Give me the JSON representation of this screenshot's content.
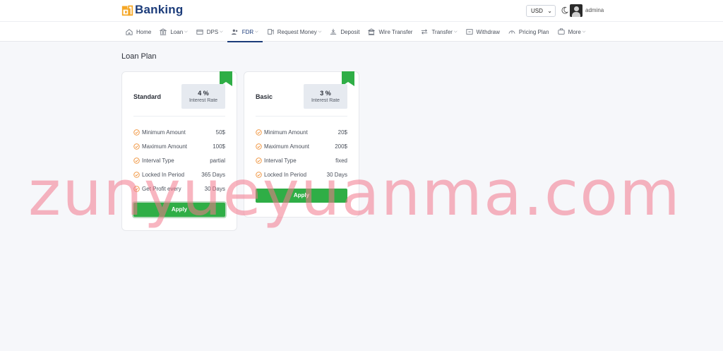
{
  "brand": {
    "name": "Banking"
  },
  "topbar": {
    "currency": "USD",
    "username": "admina"
  },
  "nav": [
    {
      "label": "Home",
      "icon": "home-icon",
      "dropdown": false
    },
    {
      "label": "Loan",
      "icon": "bank-icon",
      "dropdown": true
    },
    {
      "label": "DPS",
      "icon": "card-icon",
      "dropdown": true
    },
    {
      "label": "FDR",
      "icon": "users-icon",
      "dropdown": true,
      "active": true
    },
    {
      "label": "Request Money",
      "icon": "request-money-icon",
      "dropdown": true
    },
    {
      "label": "Deposit",
      "icon": "deposit-icon",
      "dropdown": false
    },
    {
      "label": "Wire Transfer",
      "icon": "wire-transfer-icon",
      "dropdown": false
    },
    {
      "label": "Transfer",
      "icon": "transfer-icon",
      "dropdown": true
    },
    {
      "label": "Withdraw",
      "icon": "withdraw-icon",
      "dropdown": false
    },
    {
      "label": "Pricing Plan",
      "icon": "pricing-plan-icon",
      "dropdown": false
    },
    {
      "label": "More",
      "icon": "more-icon",
      "dropdown": true
    }
  ],
  "page": {
    "title": "Loan Plan"
  },
  "plans": [
    {
      "name": "Standard",
      "rate": "4 %",
      "rate_label": "Interest Rate",
      "rows": [
        {
          "label": "Minimum Amount",
          "value": "50$"
        },
        {
          "label": "Maximum Amount",
          "value": "100$"
        },
        {
          "label": "Interval Type",
          "value": "partial"
        },
        {
          "label": "Locked In Period",
          "value": "365 Days"
        },
        {
          "label": "Get Profit every",
          "value": "30 Days"
        }
      ],
      "button": "Apply"
    },
    {
      "name": "Basic",
      "rate": "3 %",
      "rate_label": "Interest Rate",
      "rows": [
        {
          "label": "Minimum Amount",
          "value": "20$"
        },
        {
          "label": "Maximum Amount",
          "value": "200$"
        },
        {
          "label": "Interval Type",
          "value": "fixed"
        },
        {
          "label": "Locked In Period",
          "value": "30 Days"
        }
      ],
      "button": "Apply"
    }
  ],
  "watermark": "zunyueyuanma.com",
  "colors": {
    "brand": "#1c3c7a",
    "accent_green": "#2fae46",
    "check_orange": "#f0923a",
    "page_bg": "#f6f7fa"
  }
}
